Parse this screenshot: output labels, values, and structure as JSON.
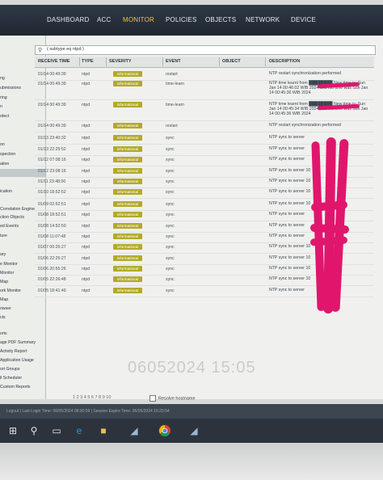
{
  "nav": {
    "tabs": [
      "DASHBOARD",
      "ACC",
      "MONITOR",
      "POLICIES",
      "OBJECTS",
      "NETWORK",
      "DEVICE"
    ],
    "active": "MONITOR"
  },
  "sidebar": {
    "items": [
      "ng",
      "ubmissions",
      "ring",
      "n",
      "otect",
      "on",
      "spection",
      "ation",
      "ication",
      "Correlation Engine",
      "ction Objects",
      "ed Events",
      "ture",
      "ary",
      "e Monitor",
      "Monitor",
      "Map",
      "ork Monitor",
      "Map",
      "owser",
      "cts",
      "orts",
      "age PDF Summary",
      "Activity Report",
      "Application Usage",
      "ort Groups",
      "il Scheduler",
      "Custom Reports"
    ]
  },
  "filter": {
    "value": "( subtype eq ntpd )"
  },
  "table": {
    "columns": [
      "RECEIVE TIME",
      "TYPE",
      "SEVERITY",
      "EVENT",
      "OBJECT",
      "DESCRIPTION"
    ],
    "rows": [
      {
        "time": "01/14 00:49:39",
        "type": "ntpd",
        "severity": "informational",
        "event": "restart",
        "object": "",
        "description": "NTP restart synchronization performed"
      },
      {
        "time": "01/14 00:49:39",
        "type": "ntpd",
        "severity": "informational",
        "event": "time-learn",
        "object": "",
        "description": "NTP time learnt from ████████ New time is: Sun Jan 14 00:46:02 WIB 2024 and old time was Sun Jan 14 00:45:36 WIB 2024"
      },
      {
        "time": "01/14 00:49:39",
        "type": "ntpd",
        "severity": "informational",
        "event": "time-learn",
        "object": "",
        "description": "NTP time learnt from ████████ New time is: Sun Jan 14 00:45:34 WIB 2024 and old time was Sun Jan 14 00:45:36 WIB 2024"
      },
      {
        "time": "01/14 00:49:39",
        "type": "ntpd",
        "severity": "informational",
        "event": "restart",
        "object": "",
        "description": "NTP restart synchronization performed"
      },
      {
        "time": "01/13 23:40:32",
        "type": "ntpd",
        "severity": "informational",
        "event": "sync",
        "object": "",
        "description": "NTP sync to server"
      },
      {
        "time": "01/13 22:25:52",
        "type": "ntpd",
        "severity": "informational",
        "event": "sync",
        "object": "",
        "description": "NTP sync to server"
      },
      {
        "time": "01/12 07:08:16",
        "type": "ntpd",
        "severity": "informational",
        "event": "sync",
        "object": "",
        "description": "NTP sync to server"
      },
      {
        "time": "01/12 23:08:16",
        "type": "ntpd",
        "severity": "informational",
        "event": "sync",
        "object": "",
        "description": "NTP sync to server 10"
      },
      {
        "time": "01/11 23:48:00",
        "type": "ntpd",
        "severity": "informational",
        "event": "sync",
        "object": "",
        "description": "NTP sync to server 10"
      },
      {
        "time": "01/10 18:52:52",
        "type": "ntpd",
        "severity": "informational",
        "event": "sync",
        "object": "",
        "description": "NTP sync to server 10"
      },
      {
        "time": "01/09 02:52:51",
        "type": "ntpd",
        "severity": "informational",
        "event": "sync",
        "object": "",
        "description": "NTP sync to server 10"
      },
      {
        "time": "01/08 18:52:51",
        "type": "ntpd",
        "severity": "informational",
        "event": "sync",
        "object": "",
        "description": "NTP sync to server"
      },
      {
        "time": "01/08 14:52:50",
        "type": "ntpd",
        "severity": "informational",
        "event": "sync",
        "object": "",
        "description": "NTP sync to server"
      },
      {
        "time": "01/08 11:07:48",
        "type": "ntpd",
        "severity": "informational",
        "event": "sync",
        "object": "",
        "description": "NTP sync to server"
      },
      {
        "time": "01/07 00:25:27",
        "type": "ntpd",
        "severity": "informational",
        "event": "sync",
        "object": "",
        "description": "NTP sync to server 10"
      },
      {
        "time": "01/06 22:25:27",
        "type": "ntpd",
        "severity": "informational",
        "event": "sync",
        "object": "",
        "description": "NTP sync to server 10"
      },
      {
        "time": "01/06 20:55:26",
        "type": "ntpd",
        "severity": "informational",
        "event": "sync",
        "object": "",
        "description": "NTP sync to server 10"
      },
      {
        "time": "01/05 22:26:48",
        "type": "ntpd",
        "severity": "informational",
        "event": "sync",
        "object": "",
        "description": "NTP sync to server 10"
      },
      {
        "time": "01/05 18:41:49",
        "type": "ntpd",
        "severity": "informational",
        "event": "sync",
        "object": "",
        "description": "NTP sync to server"
      }
    ]
  },
  "pager": {
    "text": "1 2 3 4 5 6 7 8 9 10"
  },
  "resolve": {
    "label": "Resolve hostname"
  },
  "watermark": "06052024 15:05",
  "status": {
    "text": "Logout | Last Login Time: 06/05/2024 08:00:59 | Session Expire Time: 06/05/2024 15:20:54"
  },
  "colors": {
    "nav_bg": "#26303b",
    "active_tab": "#f3c23a",
    "severity_bg": "#b3a92a",
    "redaction": "#e0166d"
  },
  "taskbar_icons": [
    "windows-icon",
    "search-icon",
    "task-view-icon",
    "edge-icon",
    "file-explorer-icon",
    "app-icon",
    "chrome-icon",
    "app-icon"
  ]
}
